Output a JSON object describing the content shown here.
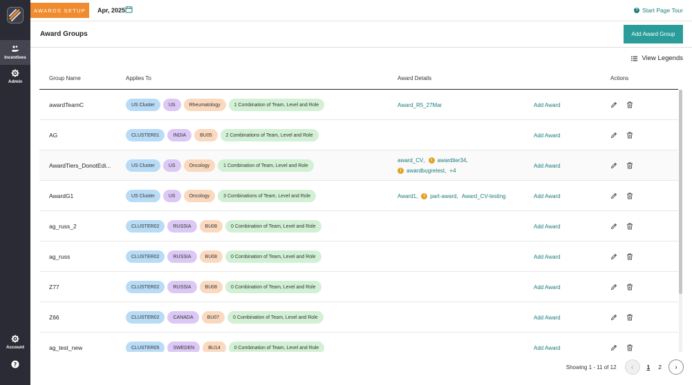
{
  "sidebar": {
    "items": [
      {
        "label": "Incentives",
        "icon": "hand-coins-icon",
        "active": true
      },
      {
        "label": "Admin",
        "icon": "gear-icon",
        "active": false
      }
    ],
    "bottom": [
      {
        "label": "Account",
        "icon": "gear-icon"
      },
      {
        "label": "",
        "icon": "help-icon"
      }
    ]
  },
  "topbar": {
    "section": "AWARDS SETUP",
    "period": "Apr, 2025",
    "tour_label": "Start Page Tour"
  },
  "page": {
    "title": "Award Groups",
    "add_group_label": "Add Award Group",
    "legends_label": "View Legends"
  },
  "table": {
    "headers": [
      "Group Name",
      "Applies To",
      "Award Details",
      "Actions"
    ],
    "add_award_label": "Add Award",
    "rows": [
      {
        "name": "awardTeamC",
        "tags": [
          "US Cluster",
          "US",
          "Rheumatology",
          "1 Combination of Team, Level and Role"
        ],
        "details": [
          [
            {
              "text": "Award_R5_27Mar",
              "warn": false
            }
          ]
        ]
      },
      {
        "name": "AG",
        "tags": [
          "CLUSTER01",
          "INDIA",
          "BU05",
          "2 Combinations of Team, Level and Role"
        ],
        "details": []
      },
      {
        "name": "AwardTiers_DonotEdi...",
        "tags": [
          "US Cluster",
          "US",
          "Oncology",
          "1 Combination of Team, Level and Role"
        ],
        "details": [
          [
            {
              "text": "award_CV",
              "warn": false
            },
            {
              "text": "awardtier34",
              "warn": true
            }
          ],
          [
            {
              "text": "awardbugretest",
              "warn": true
            },
            {
              "text": "+4",
              "warn": false
            }
          ]
        ]
      },
      {
        "name": "AwardG1",
        "tags": [
          "US Cluster",
          "US",
          "Oncology",
          "3 Combinations of Team, Level and Role"
        ],
        "details": [
          [
            {
              "text": "Award1",
              "warn": false
            },
            {
              "text": "part-award",
              "warn": true
            },
            {
              "text": "Award_CV-testing",
              "warn": false
            }
          ]
        ]
      },
      {
        "name": "ag_russ_2",
        "tags": [
          "CLUSTER02",
          "RUSSIA",
          "BU08",
          "0 Combination of Team, Level and Role"
        ],
        "details": []
      },
      {
        "name": "ag_russ",
        "tags": [
          "CLUSTER02",
          "RUSSIA",
          "BU08",
          "0 Combination of Team, Level and Role"
        ],
        "details": []
      },
      {
        "name": "Z77",
        "tags": [
          "CLUSTER02",
          "RUSSIA",
          "BU08",
          "0 Combination of Team, Level and Role"
        ],
        "details": []
      },
      {
        "name": "Z66",
        "tags": [
          "CLUSTER02",
          "CANADA",
          "BU07",
          "0 Combination of Team, Level and Role"
        ],
        "details": []
      },
      {
        "name": "ag_test_new",
        "tags": [
          "CLUSTER05",
          "SWEDEN",
          "BU14",
          "0 Combination of Team, Level and Role"
        ],
        "details": []
      }
    ]
  },
  "pagination": {
    "showing": "Showing 1 - 11 of 12",
    "pages": [
      "1",
      "2"
    ],
    "current": "1"
  },
  "colors": {
    "accent": "#2a9d9a",
    "badge": "#f08c2f",
    "link": "#1c7b7b",
    "sidebar": "#2b2b35"
  }
}
